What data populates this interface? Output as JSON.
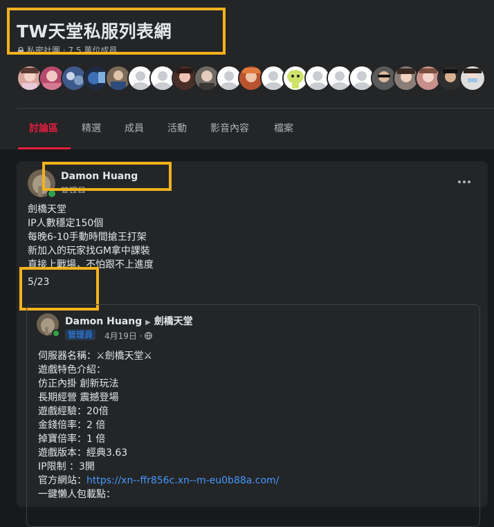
{
  "group": {
    "title": "TW天堂私服列表網",
    "meta": "私密社團 · 7.5 萬位成員"
  },
  "colors": {
    "highlight": "#f5b21e",
    "accent": "#e41e3f",
    "background": "#18191a",
    "card": "#242526",
    "link": "#4599ff"
  },
  "tabs": [
    {
      "label": "討論區",
      "active": true
    },
    {
      "label": "精選"
    },
    {
      "label": "成員"
    },
    {
      "label": "活動"
    },
    {
      "label": "影音內容"
    },
    {
      "label": "檔案"
    }
  ],
  "post": {
    "author": "Damon Huang",
    "role": "管理員",
    "lines": [
      "劍橋天堂",
      "IP人數穩定150個",
      "每晚6-10手動時間搶王打架",
      "新加入的玩家找GM拿中課裝",
      "直接上戰場，不怕跟不上進度"
    ],
    "date_text": "5/23",
    "shared": {
      "author": "Damon Huang",
      "target": "劍橋天堂",
      "badge": "管理員",
      "time": "4月19日 ·",
      "lines": [
        "伺服器名稱：⚔劍橋天堂⚔",
        "遊戲特色介紹：",
        "仿正內掛 創新玩法",
        "長期經營 震撼登場",
        "遊戲經驗：20倍",
        "金錢倍率：2 倍",
        "掉寶倍率：1 倍",
        "遊戲版本：經典3.63",
        "IP限制 ：3開"
      ],
      "site_label": "官方網站：",
      "site_url": "https://xn--ffr856c.xn--m-eu0b88a.com/",
      "last_line": "一鍵懶人包載點："
    }
  }
}
